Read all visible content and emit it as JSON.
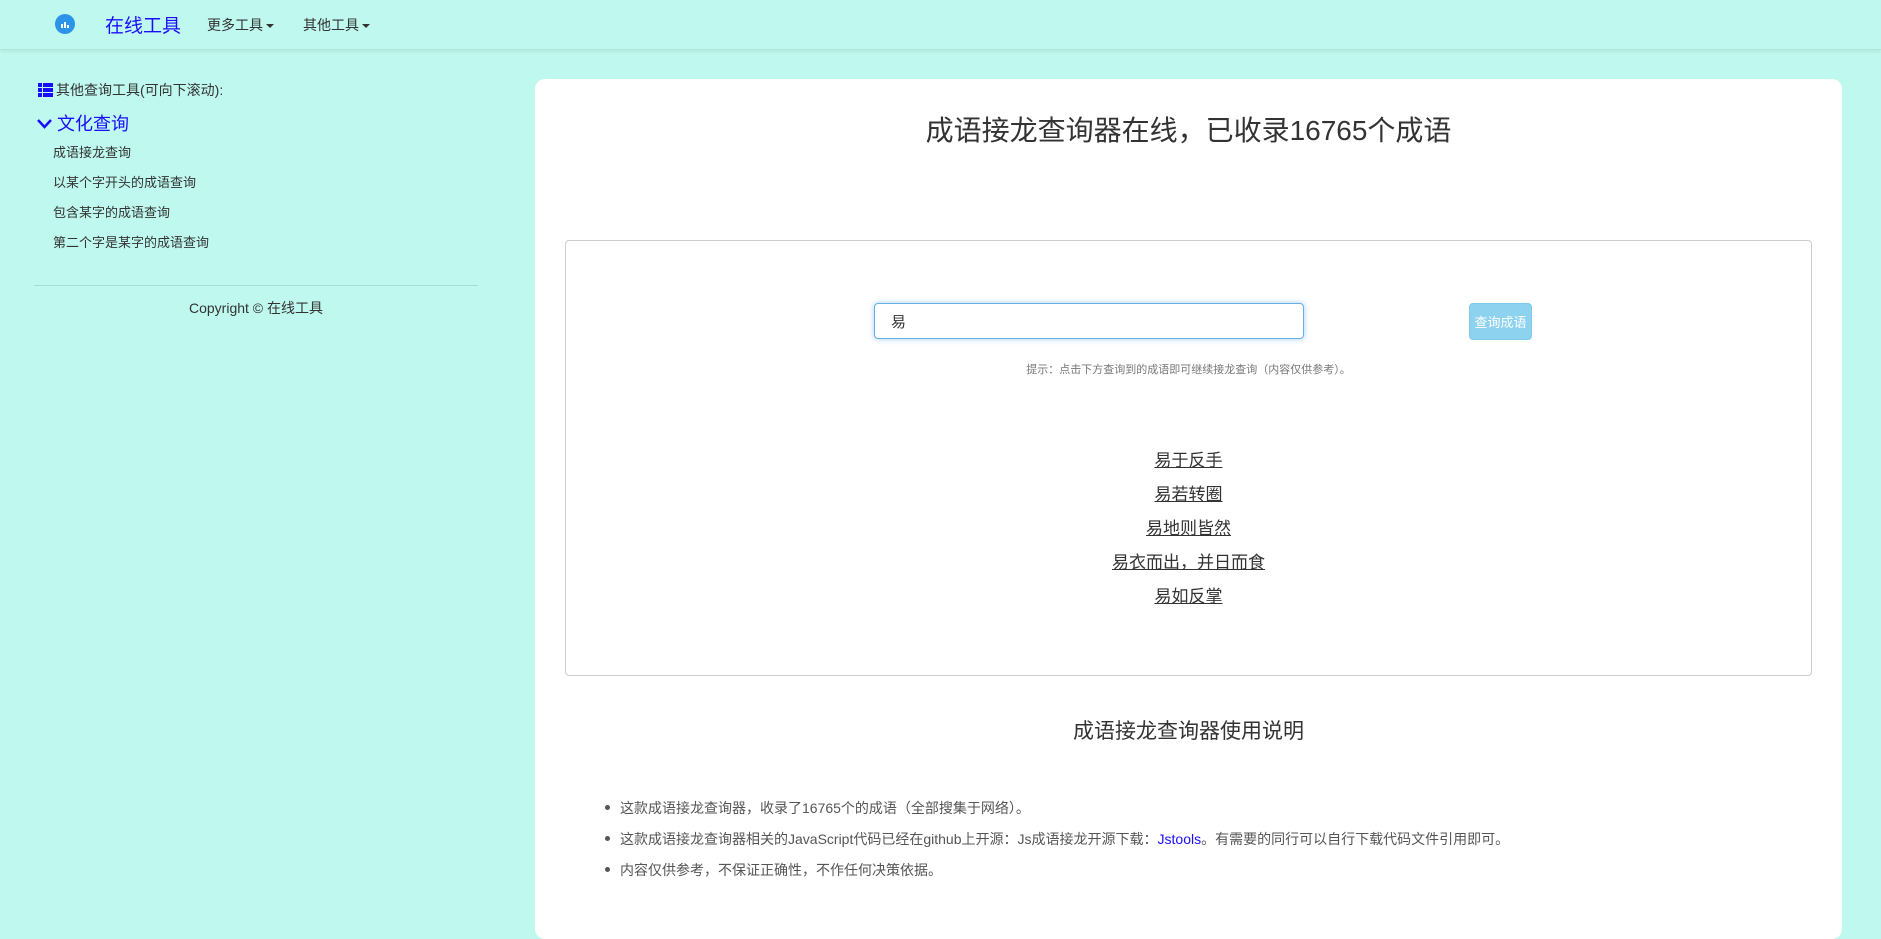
{
  "nav": {
    "brand": "在线工具",
    "menus": [
      "更多工具",
      "其他工具"
    ]
  },
  "sidebar": {
    "header": "其他查询工具(可向下滚动):",
    "category": "文化查询",
    "items": [
      "成语接龙查询",
      "以某个字开头的成语查询",
      "包含某字的成语查询",
      "第二个字是某字的成语查询"
    ],
    "copyright": "Copyright © 在线工具"
  },
  "main": {
    "title": "成语接龙查询器在线，已收录16765个成语",
    "search": {
      "value": "易",
      "button": "查询成语"
    },
    "hint": "提示：点击下方查询到的成语即可继续接龙查询（内容仅供参考）。",
    "results": [
      "易于反手",
      "易若转圈",
      "易地则皆然",
      "易衣而出，并日而食",
      "易如反掌"
    ],
    "usage_title": "成语接龙查询器使用说明",
    "notes": {
      "n1": "这款成语接龙查询器，收录了16765个的成语（全部搜集于网络）。",
      "n2_before": "这款成语接龙查询器相关的JavaScript代码已经在github上开源：Js成语接龙开源下载：",
      "n2_link": "Jstools",
      "n2_after": "。有需要的同行可以自行下载代码文件引用即可。",
      "n3": "内容仅供参考，不保证正确性，不作任何决策依据。"
    }
  },
  "colors": {
    "background": "#bff8ee",
    "link": "#1a0dff",
    "button": "#8dd3f0"
  }
}
